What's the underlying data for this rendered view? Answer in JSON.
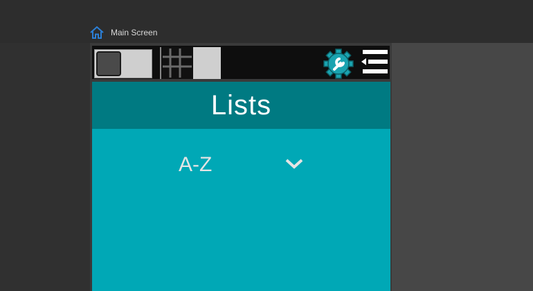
{
  "breadcrumb": {
    "label": "Main Screen",
    "icon": "home-icon",
    "icon_color": "#2b7fd6"
  },
  "toolbar": {
    "toggle_icon": "toggle-switch-icon",
    "grid_toggle_icon": "grid-icon",
    "settings_icon": "gear-wrench-icon",
    "menu_icon": "menu-collapse-icon",
    "accent": "#1aa3b0"
  },
  "header": {
    "title": "Lists",
    "bg_color": "#007a82"
  },
  "main": {
    "sort": {
      "selected": "A-Z",
      "dropdown_icon": "chevron-down-icon"
    },
    "bg_color": "#00a8b6"
  }
}
